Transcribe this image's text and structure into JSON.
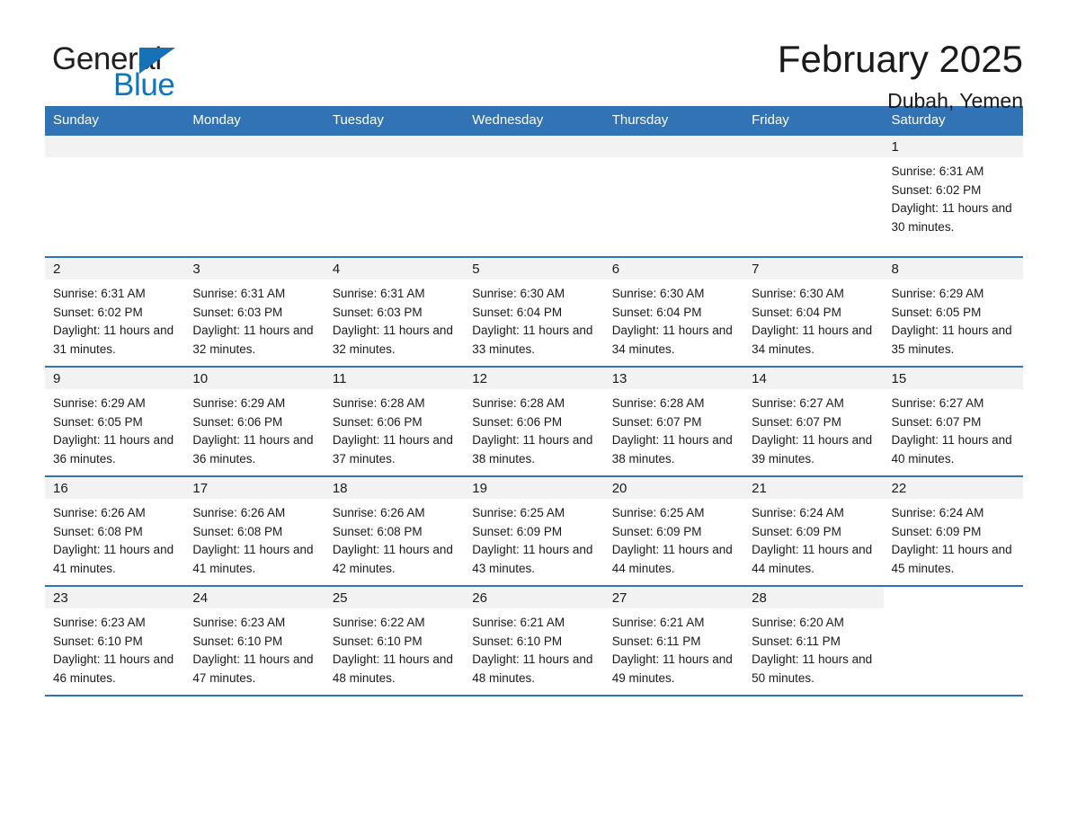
{
  "brand": {
    "word_general": "General",
    "word_blue": "Blue",
    "triangle_color": "#1572b8"
  },
  "header": {
    "title": "February 2025",
    "subtitle": "Dubah, Yemen"
  },
  "theme": {
    "header_blue": "#3273b5",
    "daynum_bg": "#f2f2f2",
    "text": "#1a1a1a"
  },
  "calendar": {
    "weekday_headers": [
      "Sunday",
      "Monday",
      "Tuesday",
      "Wednesday",
      "Thursday",
      "Friday",
      "Saturday"
    ],
    "weeks": [
      [
        {
          "day": "",
          "lines": []
        },
        {
          "day": "",
          "lines": []
        },
        {
          "day": "",
          "lines": []
        },
        {
          "day": "",
          "lines": []
        },
        {
          "day": "",
          "lines": []
        },
        {
          "day": "",
          "lines": []
        },
        {
          "day": "1",
          "lines": [
            "Sunrise: 6:31 AM",
            "Sunset: 6:02 PM",
            "Daylight: 11 hours and 30 minutes."
          ]
        }
      ],
      [
        {
          "day": "2",
          "lines": [
            "Sunrise: 6:31 AM",
            "Sunset: 6:02 PM",
            "Daylight: 11 hours and 31 minutes."
          ]
        },
        {
          "day": "3",
          "lines": [
            "Sunrise: 6:31 AM",
            "Sunset: 6:03 PM",
            "Daylight: 11 hours and 32 minutes."
          ]
        },
        {
          "day": "4",
          "lines": [
            "Sunrise: 6:31 AM",
            "Sunset: 6:03 PM",
            "Daylight: 11 hours and 32 minutes."
          ]
        },
        {
          "day": "5",
          "lines": [
            "Sunrise: 6:30 AM",
            "Sunset: 6:04 PM",
            "Daylight: 11 hours and 33 minutes."
          ]
        },
        {
          "day": "6",
          "lines": [
            "Sunrise: 6:30 AM",
            "Sunset: 6:04 PM",
            "Daylight: 11 hours and 34 minutes."
          ]
        },
        {
          "day": "7",
          "lines": [
            "Sunrise: 6:30 AM",
            "Sunset: 6:04 PM",
            "Daylight: 11 hours and 34 minutes."
          ]
        },
        {
          "day": "8",
          "lines": [
            "Sunrise: 6:29 AM",
            "Sunset: 6:05 PM",
            "Daylight: 11 hours and 35 minutes."
          ]
        }
      ],
      [
        {
          "day": "9",
          "lines": [
            "Sunrise: 6:29 AM",
            "Sunset: 6:05 PM",
            "Daylight: 11 hours and 36 minutes."
          ]
        },
        {
          "day": "10",
          "lines": [
            "Sunrise: 6:29 AM",
            "Sunset: 6:06 PM",
            "Daylight: 11 hours and 36 minutes."
          ]
        },
        {
          "day": "11",
          "lines": [
            "Sunrise: 6:28 AM",
            "Sunset: 6:06 PM",
            "Daylight: 11 hours and 37 minutes."
          ]
        },
        {
          "day": "12",
          "lines": [
            "Sunrise: 6:28 AM",
            "Sunset: 6:06 PM",
            "Daylight: 11 hours and 38 minutes."
          ]
        },
        {
          "day": "13",
          "lines": [
            "Sunrise: 6:28 AM",
            "Sunset: 6:07 PM",
            "Daylight: 11 hours and 38 minutes."
          ]
        },
        {
          "day": "14",
          "lines": [
            "Sunrise: 6:27 AM",
            "Sunset: 6:07 PM",
            "Daylight: 11 hours and 39 minutes."
          ]
        },
        {
          "day": "15",
          "lines": [
            "Sunrise: 6:27 AM",
            "Sunset: 6:07 PM",
            "Daylight: 11 hours and 40 minutes."
          ]
        }
      ],
      [
        {
          "day": "16",
          "lines": [
            "Sunrise: 6:26 AM",
            "Sunset: 6:08 PM",
            "Daylight: 11 hours and 41 minutes."
          ]
        },
        {
          "day": "17",
          "lines": [
            "Sunrise: 6:26 AM",
            "Sunset: 6:08 PM",
            "Daylight: 11 hours and 41 minutes."
          ]
        },
        {
          "day": "18",
          "lines": [
            "Sunrise: 6:26 AM",
            "Sunset: 6:08 PM",
            "Daylight: 11 hours and 42 minutes."
          ]
        },
        {
          "day": "19",
          "lines": [
            "Sunrise: 6:25 AM",
            "Sunset: 6:09 PM",
            "Daylight: 11 hours and 43 minutes."
          ]
        },
        {
          "day": "20",
          "lines": [
            "Sunrise: 6:25 AM",
            "Sunset: 6:09 PM",
            "Daylight: 11 hours and 44 minutes."
          ]
        },
        {
          "day": "21",
          "lines": [
            "Sunrise: 6:24 AM",
            "Sunset: 6:09 PM",
            "Daylight: 11 hours and 44 minutes."
          ]
        },
        {
          "day": "22",
          "lines": [
            "Sunrise: 6:24 AM",
            "Sunset: 6:09 PM",
            "Daylight: 11 hours and 45 minutes."
          ]
        }
      ],
      [
        {
          "day": "23",
          "lines": [
            "Sunrise: 6:23 AM",
            "Sunset: 6:10 PM",
            "Daylight: 11 hours and 46 minutes."
          ]
        },
        {
          "day": "24",
          "lines": [
            "Sunrise: 6:23 AM",
            "Sunset: 6:10 PM",
            "Daylight: 11 hours and 47 minutes."
          ]
        },
        {
          "day": "25",
          "lines": [
            "Sunrise: 6:22 AM",
            "Sunset: 6:10 PM",
            "Daylight: 11 hours and 48 minutes."
          ]
        },
        {
          "day": "26",
          "lines": [
            "Sunrise: 6:21 AM",
            "Sunset: 6:10 PM",
            "Daylight: 11 hours and 48 minutes."
          ]
        },
        {
          "day": "27",
          "lines": [
            "Sunrise: 6:21 AM",
            "Sunset: 6:11 PM",
            "Daylight: 11 hours and 49 minutes."
          ]
        },
        {
          "day": "28",
          "lines": [
            "Sunrise: 6:20 AM",
            "Sunset: 6:11 PM",
            "Daylight: 11 hours and 50 minutes."
          ]
        },
        {
          "day": "",
          "lines": []
        }
      ]
    ]
  }
}
